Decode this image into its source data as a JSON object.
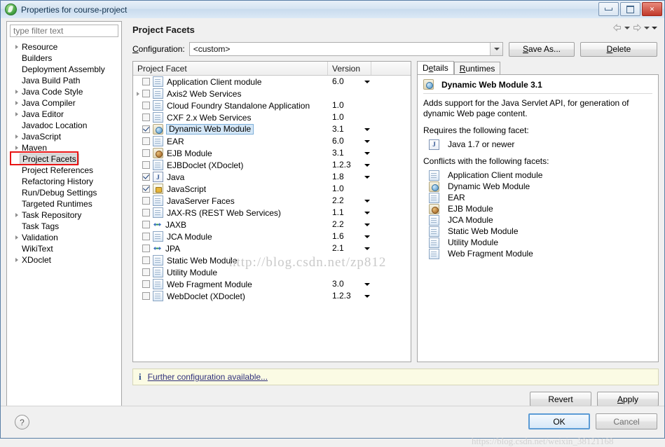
{
  "window": {
    "title": "Properties for course-project",
    "logo_icon": "eclipse-logo",
    "minimize_label": "Minimize",
    "maximize_label": "Maximize",
    "close_label": "✕"
  },
  "sidebar": {
    "filter_placeholder": "type filter text",
    "filter_value": "",
    "selected": "Project Facets",
    "items": [
      {
        "label": "Resource",
        "expandable": true
      },
      {
        "label": "Builders",
        "expandable": false
      },
      {
        "label": "Deployment Assembly",
        "expandable": false
      },
      {
        "label": "Java Build Path",
        "expandable": false
      },
      {
        "label": "Java Code Style",
        "expandable": true
      },
      {
        "label": "Java Compiler",
        "expandable": true
      },
      {
        "label": "Java Editor",
        "expandable": true
      },
      {
        "label": "Javadoc Location",
        "expandable": false
      },
      {
        "label": "JavaScript",
        "expandable": true
      },
      {
        "label": "Maven",
        "expandable": true
      },
      {
        "label": "Project Facets",
        "expandable": false
      },
      {
        "label": "Project References",
        "expandable": false
      },
      {
        "label": "Refactoring History",
        "expandable": false
      },
      {
        "label": "Run/Debug Settings",
        "expandable": false
      },
      {
        "label": "Targeted Runtimes",
        "expandable": false
      },
      {
        "label": "Task Repository",
        "expandable": true
      },
      {
        "label": "Task Tags",
        "expandable": false
      },
      {
        "label": "Validation",
        "expandable": true
      },
      {
        "label": "WikiText",
        "expandable": false
      },
      {
        "label": "XDoclet",
        "expandable": true
      }
    ]
  },
  "page": {
    "title": "Project Facets",
    "nav": {
      "back_icon": "arrow-left-icon",
      "back_caret_icon": "chevron-down-icon",
      "forward_icon": "arrow-right-icon",
      "forward_caret_icon": "chevron-down-icon",
      "menu_caret_icon": "chevron-down-icon"
    },
    "configuration": {
      "label": "Configuration:",
      "value": "<custom>",
      "dropdown_icon": "chevron-down-icon",
      "save_as_label": "Save As...",
      "delete_label": "Delete"
    }
  },
  "facet_table": {
    "columns": [
      "Project Facet",
      "Version",
      ""
    ],
    "rows": [
      {
        "name": "Application Client module",
        "version": "6.0",
        "checked": false,
        "icon": "doc-icon",
        "expandable": false,
        "has_version_dropdown": true,
        "selected": false
      },
      {
        "name": "Axis2 Web Services",
        "version": "",
        "checked": false,
        "icon": "doc-icon",
        "expandable": true,
        "has_version_dropdown": false,
        "selected": false
      },
      {
        "name": "Cloud Foundry Standalone Application",
        "version": "1.0",
        "checked": false,
        "icon": "doc-icon",
        "expandable": false,
        "has_version_dropdown": false,
        "selected": false
      },
      {
        "name": "CXF 2.x Web Services",
        "version": "1.0",
        "checked": false,
        "icon": "doc-icon",
        "expandable": false,
        "has_version_dropdown": false,
        "selected": false
      },
      {
        "name": "Dynamic Web Module",
        "version": "3.1",
        "checked": true,
        "icon": "web-module-icon",
        "expandable": false,
        "has_version_dropdown": true,
        "selected": true
      },
      {
        "name": "EAR",
        "version": "6.0",
        "checked": false,
        "icon": "doc-icon",
        "expandable": false,
        "has_version_dropdown": true,
        "selected": false
      },
      {
        "name": "EJB Module",
        "version": "3.1",
        "checked": false,
        "icon": "ejb-module-icon",
        "expandable": false,
        "has_version_dropdown": true,
        "selected": false
      },
      {
        "name": "EJBDoclet (XDoclet)",
        "version": "1.2.3",
        "checked": false,
        "icon": "doc-icon",
        "expandable": false,
        "has_version_dropdown": true,
        "selected": false
      },
      {
        "name": "Java",
        "version": "1.8",
        "checked": true,
        "icon": "java-icon",
        "expandable": false,
        "has_version_dropdown": true,
        "selected": false
      },
      {
        "name": "JavaScript",
        "version": "1.0",
        "checked": true,
        "icon": "javascript-icon",
        "expandable": false,
        "has_version_dropdown": false,
        "selected": false
      },
      {
        "name": "JavaServer Faces",
        "version": "2.2",
        "checked": false,
        "icon": "doc-icon",
        "expandable": false,
        "has_version_dropdown": true,
        "selected": false
      },
      {
        "name": "JAX-RS (REST Web Services)",
        "version": "1.1",
        "checked": false,
        "icon": "doc-icon",
        "expandable": false,
        "has_version_dropdown": true,
        "selected": false
      },
      {
        "name": "JAXB",
        "version": "2.2",
        "checked": false,
        "icon": "jaxb-icon",
        "expandable": false,
        "has_version_dropdown": true,
        "selected": false
      },
      {
        "name": "JCA Module",
        "version": "1.6",
        "checked": false,
        "icon": "doc-icon",
        "expandable": false,
        "has_version_dropdown": true,
        "selected": false
      },
      {
        "name": "JPA",
        "version": "2.1",
        "checked": false,
        "icon": "jaxb-icon",
        "expandable": false,
        "has_version_dropdown": true,
        "selected": false
      },
      {
        "name": "Static Web Module",
        "version": "",
        "checked": false,
        "icon": "doc-icon",
        "expandable": false,
        "has_version_dropdown": false,
        "selected": false
      },
      {
        "name": "Utility Module",
        "version": "",
        "checked": false,
        "icon": "doc-icon",
        "expandable": false,
        "has_version_dropdown": false,
        "selected": false
      },
      {
        "name": "Web Fragment Module",
        "version": "3.0",
        "checked": false,
        "icon": "doc-icon",
        "expandable": false,
        "has_version_dropdown": true,
        "selected": false
      },
      {
        "name": "WebDoclet (XDoclet)",
        "version": "1.2.3",
        "checked": false,
        "icon": "doc-icon",
        "expandable": false,
        "has_version_dropdown": true,
        "selected": false
      }
    ]
  },
  "details": {
    "tabs": [
      {
        "label": "Details",
        "active": true
      },
      {
        "label": "Runtimes",
        "active": false
      }
    ],
    "heading": "Dynamic Web Module 3.1",
    "heading_icon": "web-module-icon",
    "description": "Adds support for the Java Servlet API, for generation of dynamic Web page content.",
    "requires_label": "Requires the following facet:",
    "requires": [
      {
        "label": "Java 1.7 or newer",
        "icon": "java-icon"
      }
    ],
    "conflicts_label": "Conflicts with the following facets:",
    "conflicts": [
      {
        "label": "Application Client module",
        "icon": "doc-icon"
      },
      {
        "label": "Dynamic Web Module",
        "icon": "web-module-icon"
      },
      {
        "label": "EAR",
        "icon": "doc-icon"
      },
      {
        "label": "EJB Module",
        "icon": "ejb-module-icon"
      },
      {
        "label": "JCA Module",
        "icon": "doc-icon"
      },
      {
        "label": "Static Web Module",
        "icon": "doc-icon"
      },
      {
        "label": "Utility Module",
        "icon": "doc-icon"
      },
      {
        "label": "Web Fragment Module",
        "icon": "doc-icon"
      }
    ]
  },
  "infobar": {
    "icon": "info-icon",
    "text": "Further configuration available..."
  },
  "actions": {
    "revert_label": "Revert",
    "apply_label": "Apply",
    "ok_label": "OK",
    "cancel_label": "Cancel",
    "help_icon": "help-icon",
    "help_glyph": "?"
  },
  "watermarks": {
    "main": "http://blog.csdn.net/zp812",
    "bottom": "https://blog.csdn.net/weixin_38121168"
  }
}
